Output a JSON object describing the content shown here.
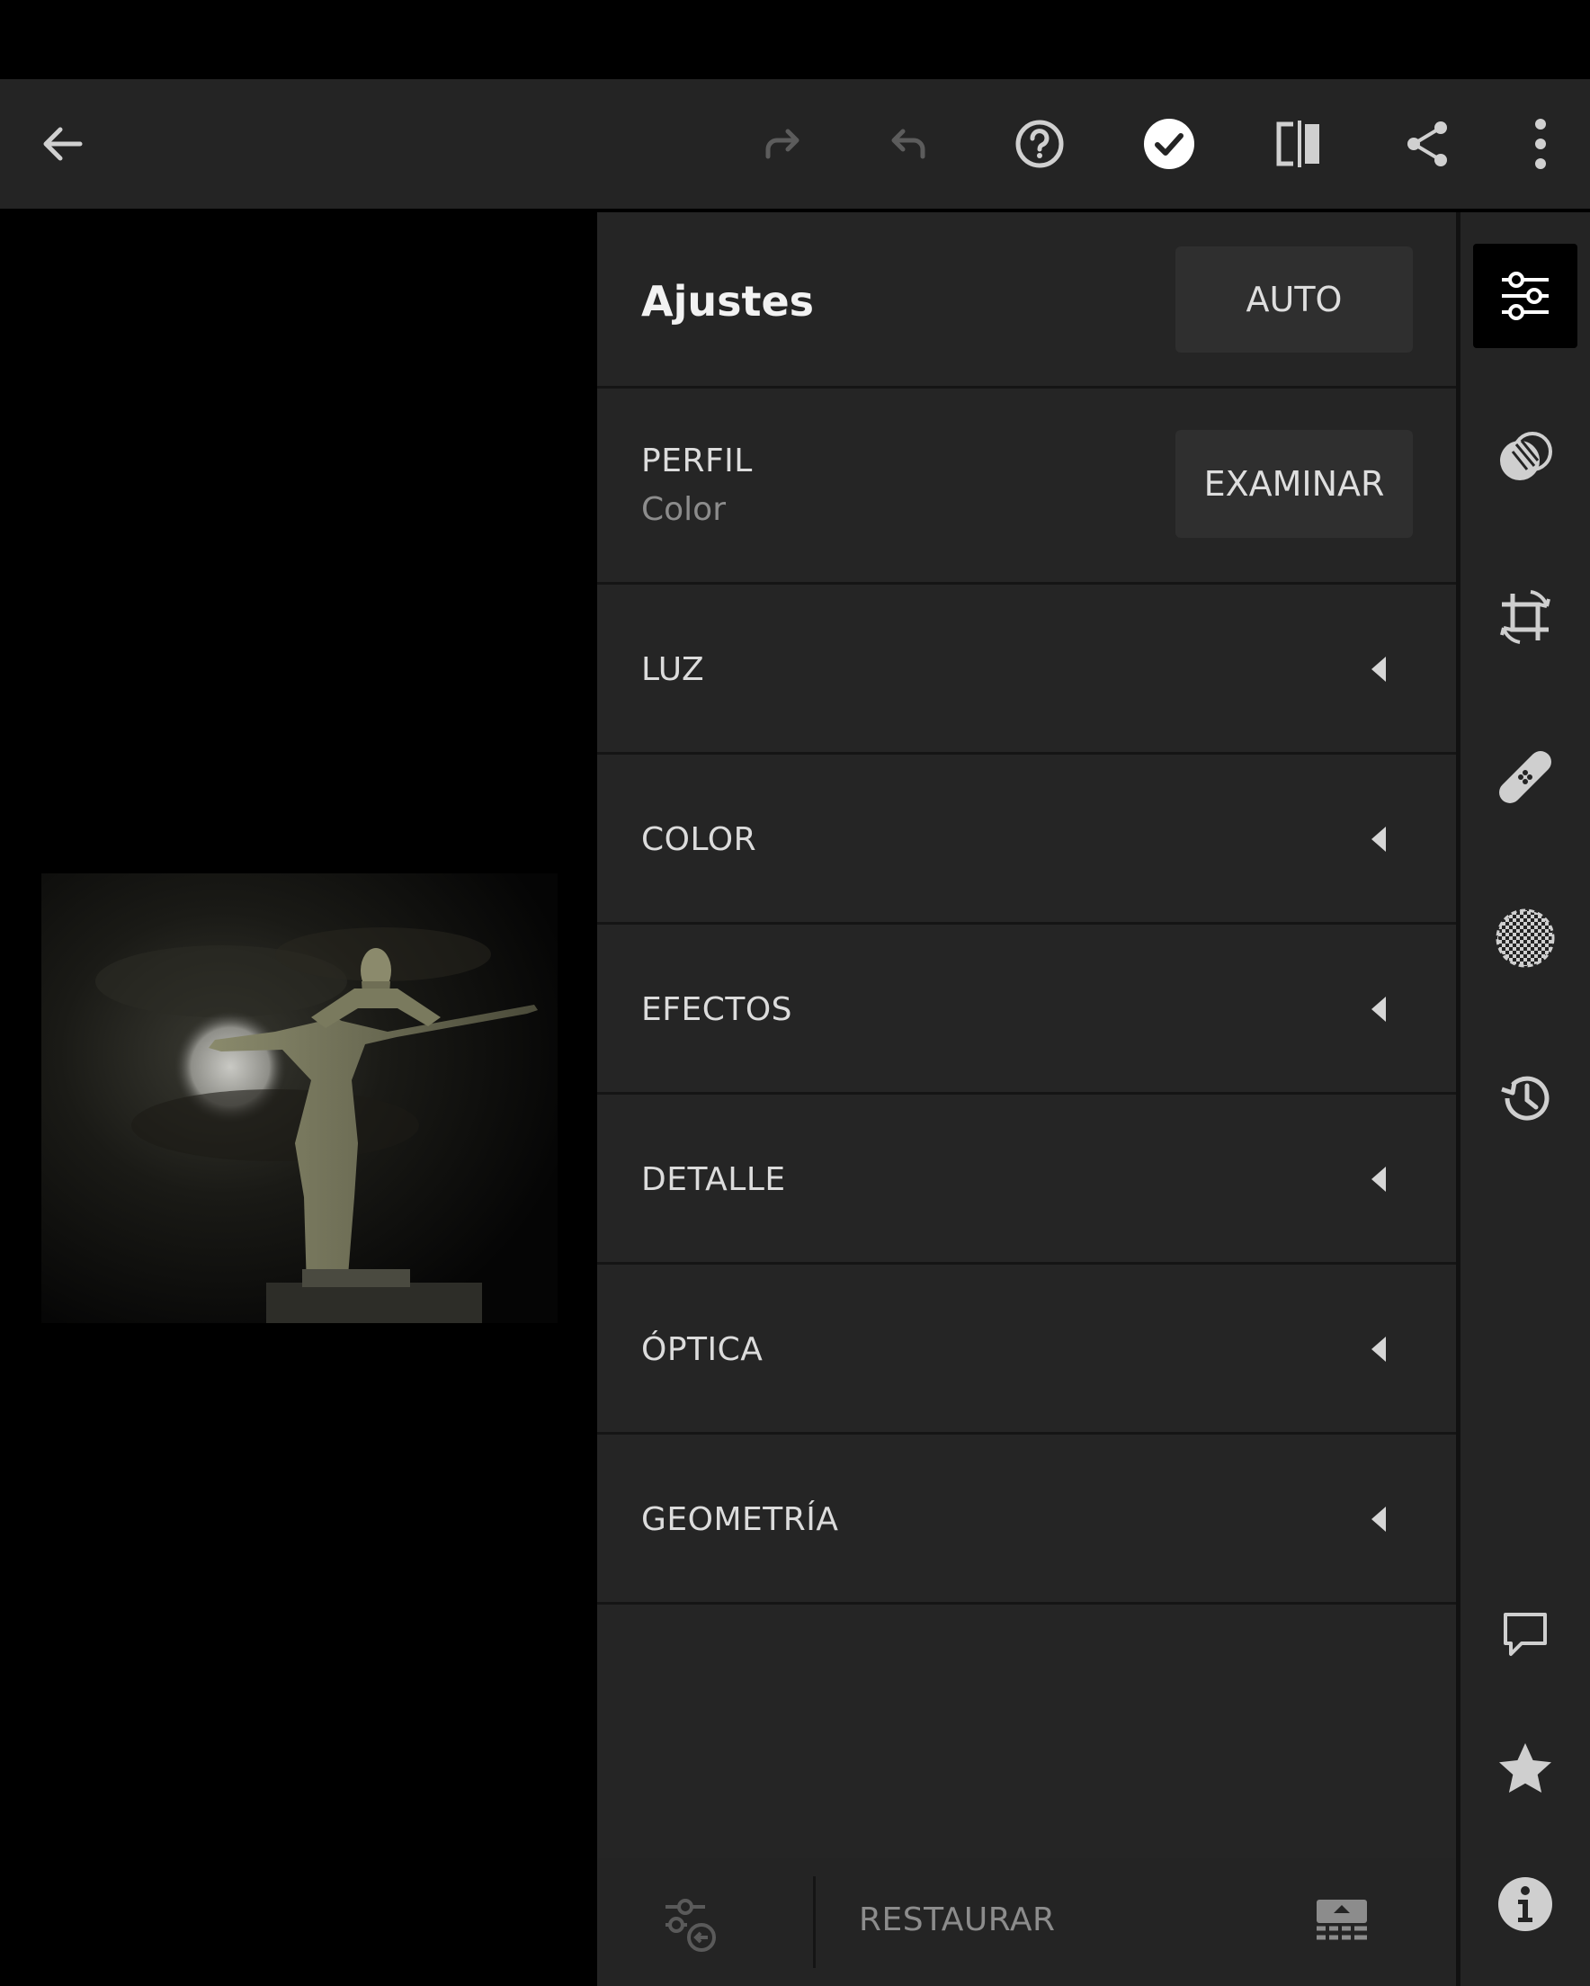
{
  "toolbar": {
    "icons": [
      "back-arrow-icon",
      "redo-icon",
      "undo-icon",
      "help-icon",
      "done-check-icon",
      "compare-icon",
      "share-icon",
      "more-vertical-icon"
    ]
  },
  "panel": {
    "title": "Ajustes",
    "auto_label": "AUTO",
    "profile": {
      "heading": "PERFIL",
      "value": "Color",
      "browse_label": "EXAMINAR"
    },
    "sections": [
      {
        "label": "LUZ"
      },
      {
        "label": "COLOR"
      },
      {
        "label": "EFECTOS"
      },
      {
        "label": "DETALLE"
      },
      {
        "label": "ÓPTICA"
      },
      {
        "label": "GEOMETRÍA"
      }
    ]
  },
  "bottom_bar": {
    "reset_label": "RESTAURAR"
  },
  "rail": {
    "icons": [
      "sliders-icon",
      "selective-icon",
      "crop-icon",
      "healing-icon",
      "masking-icon",
      "history-icon",
      "comment-icon",
      "star-icon",
      "info-icon"
    ]
  },
  "colors": {
    "panel_bg": "#252525",
    "toolbar_bg": "#242424",
    "text": "#dcdcdc",
    "muted": "#8c8c8c"
  }
}
